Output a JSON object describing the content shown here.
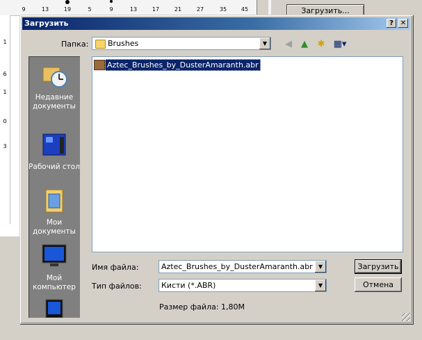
{
  "background": {
    "palette_numbers": [
      "9",
      "13",
      "19",
      "5",
      "9",
      "13",
      "17",
      "21",
      "27",
      "35",
      "45"
    ],
    "left_numbers": [
      "1",
      "6",
      "1",
      "0",
      "3"
    ],
    "load_button": "Загрузить..."
  },
  "dialog": {
    "title": "Загрузить",
    "help_button": "?",
    "close_button": "✕",
    "folder_label": "Папка:",
    "folder_value": "Brushes",
    "places": [
      {
        "label": "Недавние документы",
        "icon": "recent-documents-icon"
      },
      {
        "label": "Рабочий стол",
        "icon": "desktop-icon"
      },
      {
        "label": "Мои документы",
        "icon": "my-documents-icon"
      },
      {
        "label": "Мой компьютер",
        "icon": "my-computer-icon"
      }
    ],
    "files": [
      {
        "name": "Aztec_Brushes_by_DusterAmaranth.abr",
        "selected": true
      }
    ],
    "filename_label": "Имя файла:",
    "filename_value": "Aztec_Brushes_by_DusterAmaranth.abr",
    "filetype_label": "Тип файлов:",
    "filetype_value": "Кисти (*.ABR)",
    "open_button": "Загрузить",
    "cancel_button": "Отмена",
    "file_size": "Размер файла: 1,80М"
  },
  "colors": {
    "title_bar": "#0a246a",
    "selection": "#0a246a",
    "places_bar": "#808080"
  }
}
